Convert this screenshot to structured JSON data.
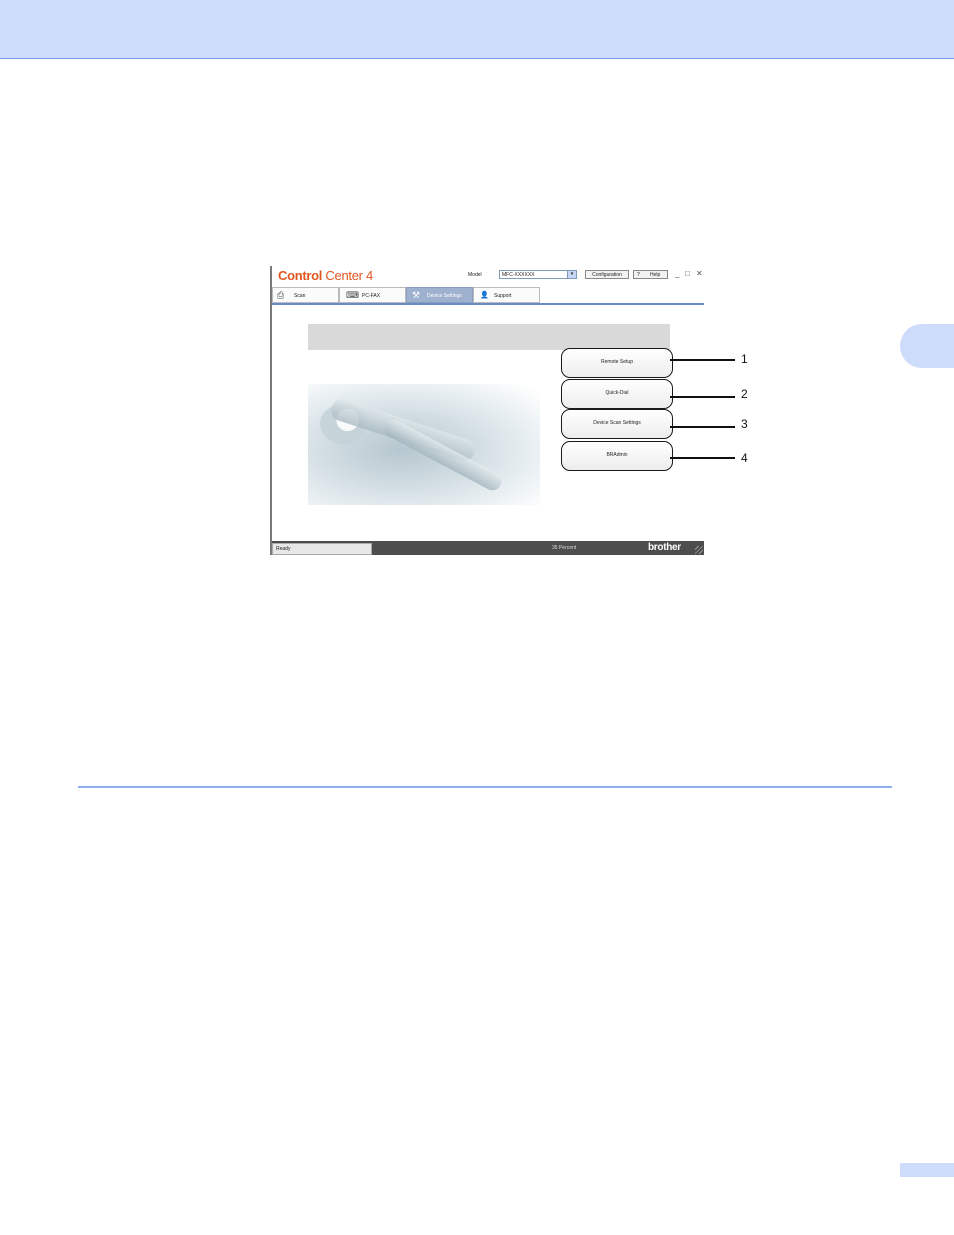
{
  "window": {
    "logo_bold": "Control",
    "logo_light": " Center 4",
    "model_label": "Model",
    "model_value": "MFC-XXXXXX",
    "configuration_label": "Configuration",
    "help_q": "?",
    "help_label": "Help",
    "win_minimize": "_",
    "win_maximize": "□",
    "win_close": "✕",
    "tabs": [
      {
        "label": "Scan",
        "icon": "scanner-icon",
        "glyph": "⎙"
      },
      {
        "label": "PC-FAX",
        "icon": "fax-icon",
        "glyph": "⌨"
      },
      {
        "label": "Device Settings",
        "icon": "tools-icon",
        "glyph": "⚒"
      },
      {
        "label": "Support",
        "icon": "person-icon",
        "glyph": "👤"
      }
    ],
    "active_tab": "Device Settings",
    "buttons": [
      {
        "label": "Remote Setup",
        "callout": "1"
      },
      {
        "label": "Quick-Dial",
        "callout": "2"
      },
      {
        "label": "Device Scan Settings",
        "callout": "3"
      },
      {
        "label": "BRAdmin",
        "callout": "4"
      }
    ],
    "status": {
      "ready": "Ready",
      "percent": "35 Percent",
      "brand": "brother"
    }
  },
  "colors": {
    "page_band": "#cddcfb",
    "logo_orange": "#e0571f",
    "active_tab": "#9eb1cf",
    "status_bar": "#4d4d4d"
  }
}
